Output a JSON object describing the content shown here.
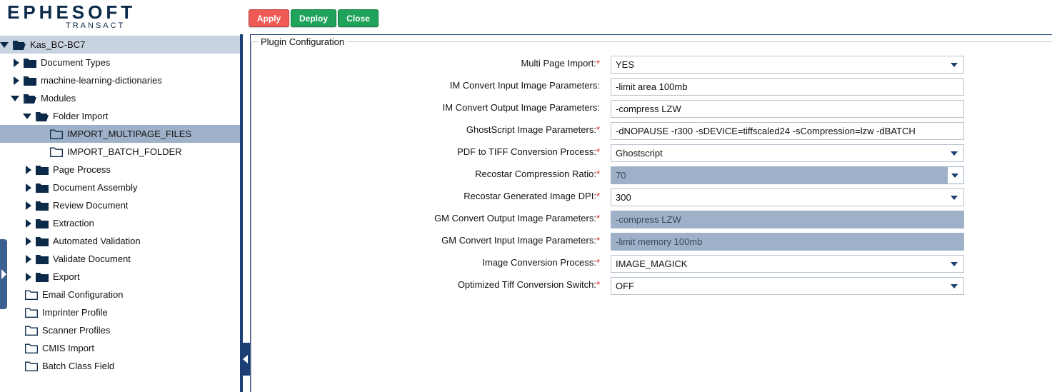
{
  "brand": {
    "name": "EPHESOFT",
    "tagline": "TRANSACT"
  },
  "toolbar": {
    "apply": "Apply",
    "deploy": "Deploy",
    "close": "Close"
  },
  "colors": {
    "apply": "#ef5a55",
    "deploy": "#1fa35a",
    "close": "#1fa35a",
    "navy": "#1c3f73",
    "selected_row": "#9eb1c9",
    "disabled_field": "#9eb1c9",
    "required": "#e02020"
  },
  "tree": {
    "root": "Kas_BC-BC7",
    "items": [
      {
        "label": "Document Types"
      },
      {
        "label": "machine-learning-dictionaries"
      },
      {
        "label": "Modules"
      },
      {
        "label": "Folder Import"
      },
      {
        "label": "IMPORT_MULTIPAGE_FILES"
      },
      {
        "label": "IMPORT_BATCH_FOLDER"
      },
      {
        "label": "Page Process"
      },
      {
        "label": "Document Assembly"
      },
      {
        "label": "Review Document"
      },
      {
        "label": "Extraction"
      },
      {
        "label": "Automated Validation"
      },
      {
        "label": "Validate Document"
      },
      {
        "label": "Export"
      },
      {
        "label": "Email Configuration"
      },
      {
        "label": "Imprinter Profile"
      },
      {
        "label": "Scanner Profiles"
      },
      {
        "label": "CMIS Import"
      },
      {
        "label": "Batch Class Field"
      }
    ]
  },
  "panel": {
    "legend": "Plugin Configuration"
  },
  "form": {
    "fields": [
      {
        "label": "Multi Page Import:",
        "required": "*",
        "value": "YES"
      },
      {
        "label": "IM Convert Input Image Parameters:",
        "required": "",
        "value": "-limit area 100mb"
      },
      {
        "label": "IM Convert Output Image Parameters:",
        "required": "",
        "value": "-compress LZW"
      },
      {
        "label": "GhostScript Image Parameters:",
        "required": "*",
        "value": "-dNOPAUSE -r300 -sDEVICE=tiffscaled24 -sCompression=lzw -dBATCH"
      },
      {
        "label": "PDF to TIFF Conversion Process:",
        "required": "*",
        "value": "Ghostscript"
      },
      {
        "label": "Recostar Compression Ratio:",
        "required": "*",
        "value": "70"
      },
      {
        "label": "Recostar Generated Image DPI:",
        "required": "*",
        "value": "300"
      },
      {
        "label": "GM Convert Output Image Parameters:",
        "required": "*",
        "value": "-compress LZW"
      },
      {
        "label": "GM Convert Input Image Parameters:",
        "required": "*",
        "value": "-limit memory 100mb"
      },
      {
        "label": "Image Conversion Process:",
        "required": "*",
        "value": "IMAGE_MAGICK"
      },
      {
        "label": "Optimized Tiff Conversion Switch:",
        "required": "*",
        "value": "OFF"
      }
    ]
  }
}
